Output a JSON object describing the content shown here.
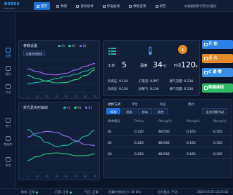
{
  "brand": {
    "name": "DOROS",
    "sub": "MAS 2020"
  },
  "nav": [
    {
      "label": "首页",
      "icon": "home-icon",
      "active": true
    },
    {
      "label": "数据",
      "icon": "data-icon",
      "active": false
    },
    {
      "label": "自动进样",
      "icon": "autosampler-icon",
      "active": false
    },
    {
      "label": "标准曲线",
      "icon": "curve-icon",
      "active": false
    },
    {
      "label": "数据查看",
      "icon": "view-icon",
      "active": false
    },
    {
      "label": "报告",
      "icon": "report-icon",
      "active": false
    }
  ],
  "top_message": "欢迎使用原子荧光光度计",
  "sidebar": [
    {
      "label": "设置",
      "icon": "settings-icon"
    },
    {
      "label": "基线",
      "icon": "baseline-icon"
    },
    {
      "label": "灯源",
      "icon": "lamp-icon"
    },
    {
      "label": "统计",
      "icon": "stats-icon"
    },
    {
      "label": "数据库",
      "icon": "database-icon"
    },
    {
      "label": "帮助",
      "icon": "help-icon"
    }
  ],
  "chart1": {
    "title": "参数设置",
    "subtitle": "仪器状态曲线",
    "legend": [
      "A1",
      "B1",
      "B2"
    ],
    "control": "仪器状态"
  },
  "chart2": {
    "title": "荧光素实时曲线",
    "legend": [
      "A1",
      "B1",
      "B2"
    ]
  },
  "stats": [
    {
      "label": "工步",
      "value": "5",
      "unit": "",
      "icon": "list-icon",
      "color": "#1fb8a8"
    },
    {
      "label": "温度",
      "value": "34",
      "unit": "℃",
      "icon": "thermometer-icon",
      "color": "#2a6fd0"
    },
    {
      "label": "时间",
      "value": "120",
      "unit": "s",
      "icon": "clock-icon",
      "color": "#e5892b"
    }
  ],
  "params": [
    {
      "label": "负高压:",
      "value": "0.134"
    },
    {
      "label": "灯电流:",
      "value": "0.097"
    },
    {
      "label": "载气流量:",
      "value": "0.134"
    },
    {
      "label": "负高压:",
      "value": "0.134"
    },
    {
      "label": "屏蔽气:",
      "value": "0.134"
    },
    {
      "label": "载气流量:",
      "value": "0.134"
    }
  ],
  "actions": [
    {
      "label": "开 始",
      "icon": "play-icon",
      "color": "#2f7fe8"
    },
    {
      "label": "点 火",
      "icon": "fire-icon",
      "color": "#e5892b"
    },
    {
      "label": "C 调 零",
      "icon": "zero-icon",
      "color": "#3a8fe8"
    },
    {
      "label": "新建曲线",
      "icon": "new-curve-icon",
      "color": "#2fb866"
    }
  ],
  "table": {
    "title": "进样方式",
    "options": [
      "单位",
      "样品",
      "模式"
    ],
    "tabs": [
      "标准",
      "校准",
      "样本",
      "质控"
    ],
    "active_tab": 0,
    "select": "全选切换(Hg)",
    "columns": [
      "样本编号",
      "PhAnu",
      "Pb(ng/L)",
      "Pb(ng/L)",
      "Pb(ng/L)"
    ],
    "rows": [
      [
        "01",
        "0.220",
        "48.056",
        "0.165",
        "0.165"
      ],
      [
        "02",
        "0.220",
        "48.056",
        "0.165",
        "0.165"
      ],
      [
        "03",
        "0.220",
        "48.056",
        "0.165",
        "0.165"
      ]
    ]
  },
  "status": {
    "conn_label": "联机:",
    "conn_value": "正常",
    "lamp_label": "灯源:",
    "lamp_value": "正常",
    "gas_label": "气压:",
    "gas_value": "正常",
    "flow_label": "石蘑炉进样压力:",
    "flow_value": "50 kPa",
    "mode_label": "运行模式:",
    "mode_value": "手动",
    "time": "2020-03-25 13:25:42"
  },
  "colors": {
    "accent": "#1f6fd6",
    "teal": "#1fb8a8",
    "green": "#2fd07a",
    "purple": "#9b6bff",
    "orange": "#e5892b"
  },
  "chart_data": [
    {
      "type": "line",
      "title": "",
      "x": [
        0,
        10,
        20,
        30,
        40,
        50,
        60,
        70
      ],
      "series": [
        {
          "name": "A1",
          "values": [
            1.6,
            1.9,
            2.2,
            2.6,
            3.0,
            3.4,
            4.0,
            4.6
          ]
        },
        {
          "name": "B1",
          "values": [
            3.2,
            2.6,
            2.1,
            1.8,
            1.9,
            2.4,
            3.2,
            4.2
          ]
        },
        {
          "name": "B2",
          "values": [
            4.4,
            3.9,
            3.4,
            3.3,
            3.6,
            4.2,
            4.9,
            5.4
          ]
        }
      ],
      "ylim": [
        0,
        6
      ]
    },
    {
      "type": "line",
      "title": "",
      "x": [
        0,
        10,
        20,
        30,
        40,
        50,
        60,
        70
      ],
      "series": [
        {
          "name": "A1",
          "values": [
            4.6,
            3.9,
            3.2,
            2.8,
            2.9,
            3.3,
            3.9,
            4.5
          ]
        },
        {
          "name": "B1",
          "values": [
            1.3,
            1.7,
            2.0,
            2.1,
            2.0,
            1.8,
            1.8,
            2.0
          ]
        },
        {
          "name": "B2",
          "values": [
            3.8,
            4.2,
            4.4,
            4.3,
            3.9,
            3.4,
            3.0,
            2.9
          ]
        }
      ],
      "ylim": [
        0,
        6
      ]
    }
  ]
}
